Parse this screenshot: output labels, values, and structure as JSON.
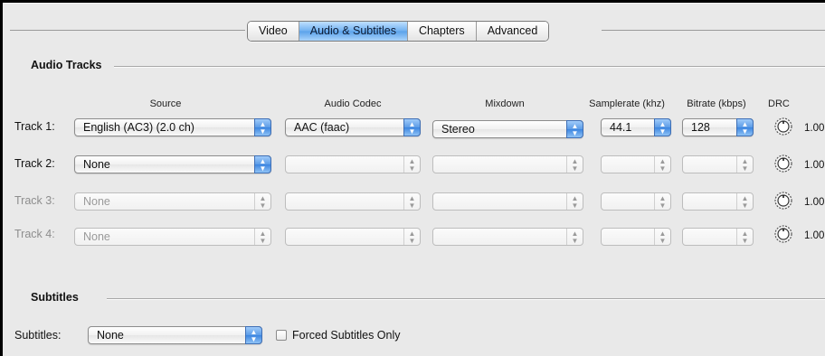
{
  "tabs": [
    "Video",
    "Audio & Subtitles",
    "Chapters",
    "Advanced"
  ],
  "active_tab": "Audio & Subtitles",
  "audio": {
    "section_title": "Audio Tracks",
    "columns": {
      "source": "Source",
      "codec": "Audio Codec",
      "mixdown": "Mixdown",
      "samplerate": "Samplerate (khz)",
      "bitrate": "Bitrate (kbps)",
      "drc": "DRC"
    },
    "tracks": [
      {
        "label": "Track 1:",
        "source": "English (AC3) (2.0 ch)",
        "codec": "AAC (faac)",
        "mixdown": "Stereo",
        "samplerate": "44.1",
        "bitrate": "128",
        "drc": "1.00"
      },
      {
        "label": "Track 2:",
        "source": "None",
        "codec": "",
        "mixdown": "",
        "samplerate": "",
        "bitrate": "",
        "drc": "1.00"
      },
      {
        "label": "Track 3:",
        "source": "None",
        "codec": "",
        "mixdown": "",
        "samplerate": "",
        "bitrate": "",
        "drc": "1.00"
      },
      {
        "label": "Track 4:",
        "source": "None",
        "codec": "",
        "mixdown": "",
        "samplerate": "",
        "bitrate": "",
        "drc": "1.00"
      }
    ]
  },
  "subtitles": {
    "section_title": "Subtitles",
    "label": "Subtitles:",
    "value": "None",
    "forced_label": "Forced Subtitles Only",
    "forced_checked": false
  },
  "icons": {
    "popup_arrow": "up-down-arrows-icon",
    "drc_knob": "knob-icon",
    "checkbox": "checkbox-icon"
  },
  "colors": {
    "accent_blue": "#5b9be7",
    "background": "#e9e9e9"
  }
}
